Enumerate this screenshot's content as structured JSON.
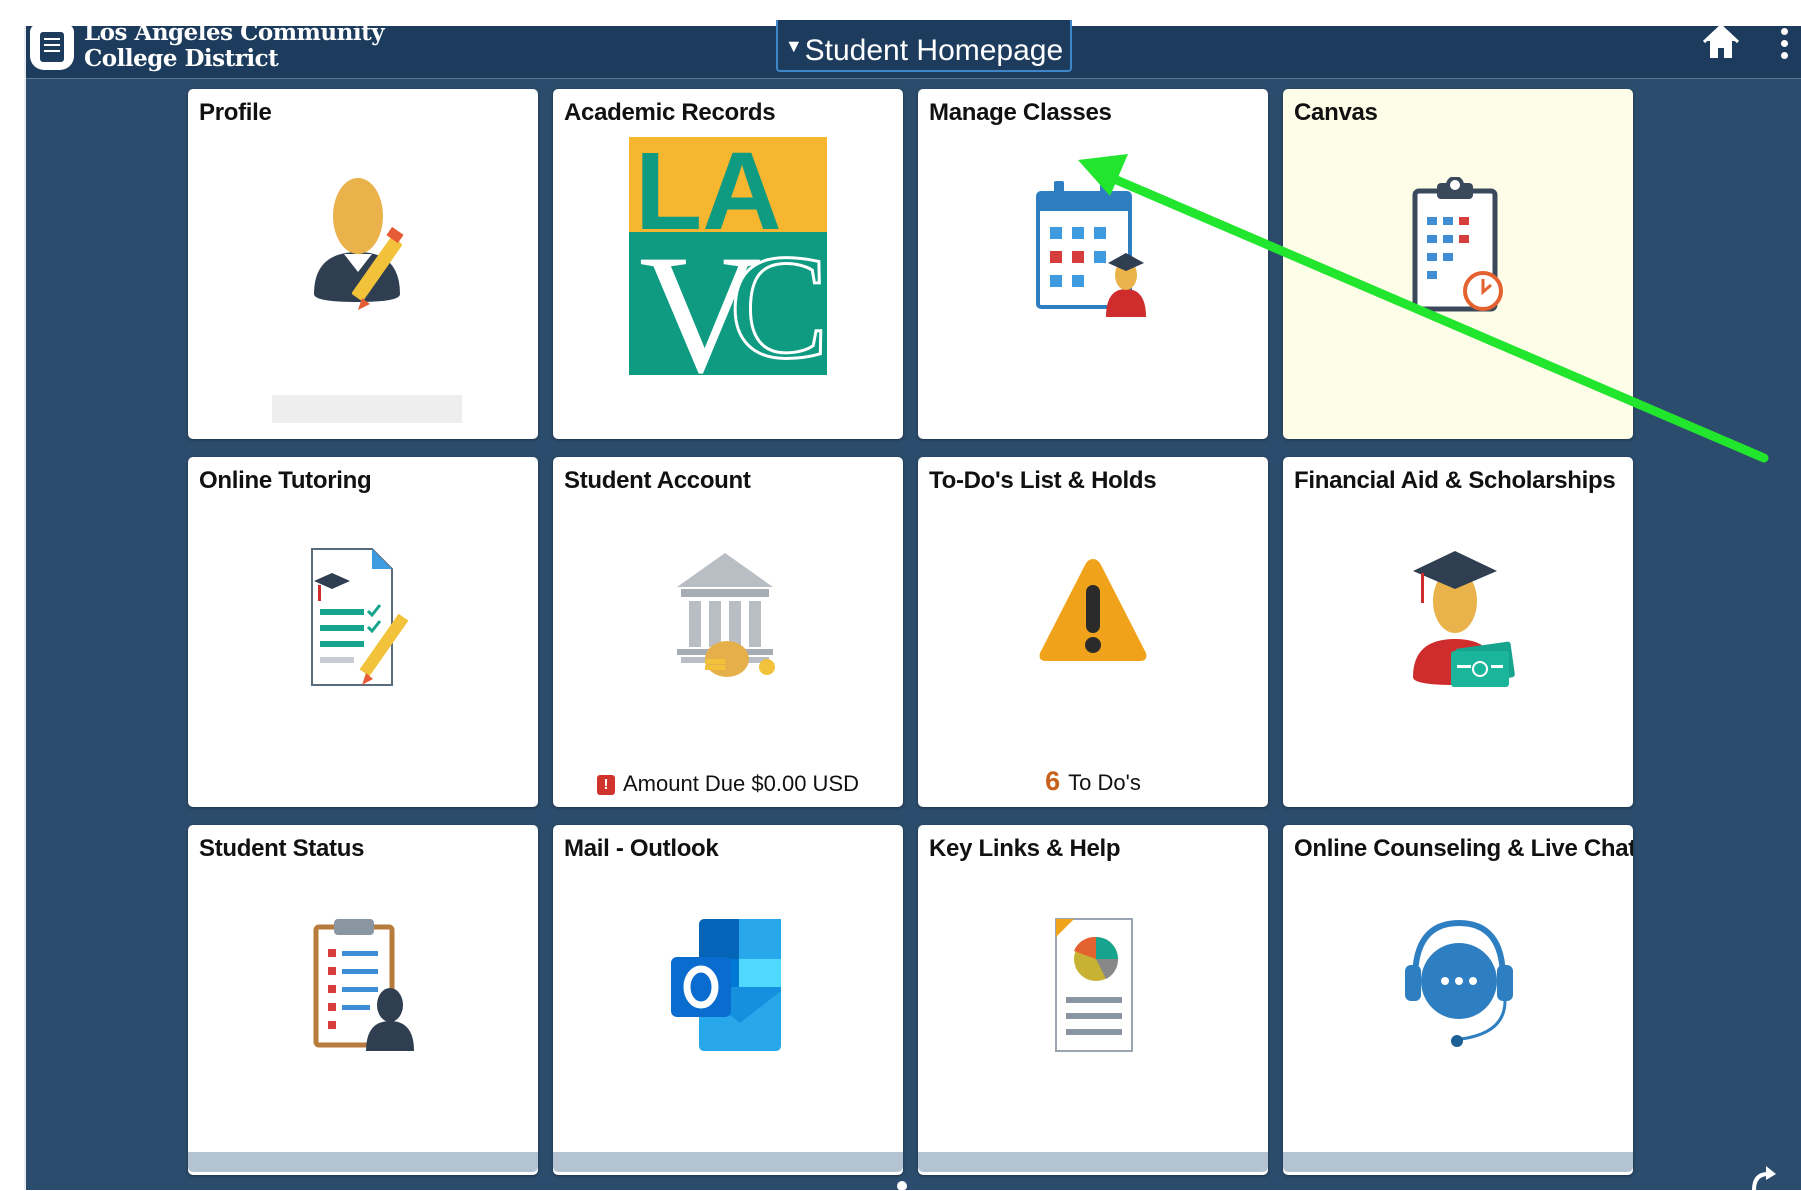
{
  "header": {
    "logo_line1": "Los Angeles Community",
    "logo_line2": "College District",
    "page_switcher_label": "Student Homepage",
    "home_icon": "home-icon",
    "menu_icon": "more-vertical-icon"
  },
  "colors": {
    "background": "#2c4c6d",
    "header": "#1d3c5d",
    "tile": "#ffffff",
    "canvas_tile": "#fdfde8",
    "annotation_arrow": "#22e52d",
    "alert_red": "#d0342c",
    "todo_count_orange": "#c7611c"
  },
  "tiles": [
    {
      "title": "Profile",
      "icon": "profile-edit-icon"
    },
    {
      "title": "Academic Records",
      "icon": "lavc-logo"
    },
    {
      "title": "Manage Classes",
      "icon": "class-calendar-icon"
    },
    {
      "title": "Canvas",
      "icon": "clipboard-clock-icon"
    },
    {
      "title": "Online Tutoring",
      "icon": "tutoring-document-icon"
    },
    {
      "title": "Student Account",
      "icon": "bank-money-icon",
      "status_text": "Amount Due $0.00 USD",
      "status_icon": "alert-icon"
    },
    {
      "title": "To-Do's List & Holds",
      "icon": "warning-icon",
      "count": "6",
      "count_label": "To Do's"
    },
    {
      "title": "Financial Aid & Scholarships",
      "icon": "graduate-money-icon"
    },
    {
      "title": "Student Status",
      "icon": "clipboard-person-icon"
    },
    {
      "title": "Mail - Outlook",
      "icon": "outlook-icon"
    },
    {
      "title": "Key Links & Help",
      "icon": "report-chart-icon"
    },
    {
      "title": "Online Counseling & Live Chat",
      "icon": "headset-chat-icon"
    }
  ],
  "lavc_logo": {
    "top": "LA",
    "bottom_v": "V",
    "bottom_c": "C"
  },
  "annotation": {
    "type": "arrow",
    "points_to": "Manage Classes"
  },
  "footer": {
    "refresh_icon": "refresh-icon"
  }
}
